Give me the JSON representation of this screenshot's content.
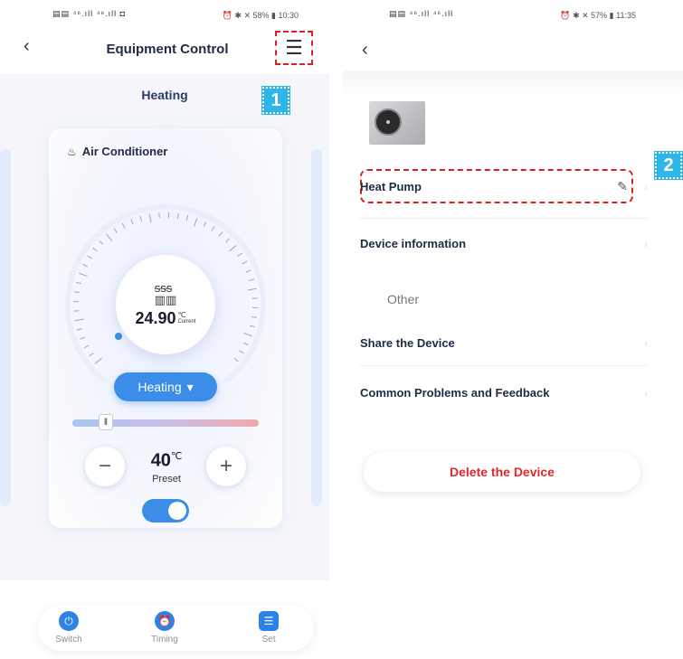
{
  "left": {
    "status": {
      "left": "▤▤ ⁴⁶.ıll ⁴⁶.ıll ◘",
      "right": "⏰ ✱ ✕ 58% ▮ 10:30"
    },
    "header": {
      "title": "Equipment Control",
      "back_icon": "chevron-left-icon",
      "menu_icon": "hamburger-menu-icon"
    },
    "subtitle": "Heating",
    "callout": "1",
    "card": {
      "device_label": "Air Conditioner",
      "current_temp": "24.90",
      "temp_unit": "℃",
      "current_label": "Current",
      "mode": "Heating",
      "preset_temp": "40",
      "preset_unit": "℃",
      "preset_label": "Preset",
      "power_on": true
    },
    "bottom_nav": [
      {
        "label": "Switch",
        "icon": "power-icon"
      },
      {
        "label": "Timing",
        "icon": "alarm-clock-icon"
      },
      {
        "label": "Set",
        "icon": "sliders-icon"
      }
    ]
  },
  "right": {
    "status": {
      "left": "▤▤ ⁴⁶.ıll ⁴⁶.ıll",
      "right": "⏰ ✱ ✕ 57% ▮ 11:35"
    },
    "callout": "2",
    "device_name": "Heat Pump",
    "rows": {
      "device_info": "Device information",
      "section_other": "Other",
      "share": "Share the Device",
      "faq": "Common Problems and Feedback"
    },
    "delete_label": "Delete the Device"
  },
  "colors": {
    "accent": "#3b8de8",
    "danger": "#e0282d",
    "callout": "#2fb6e8",
    "highlight": "#e02020"
  }
}
